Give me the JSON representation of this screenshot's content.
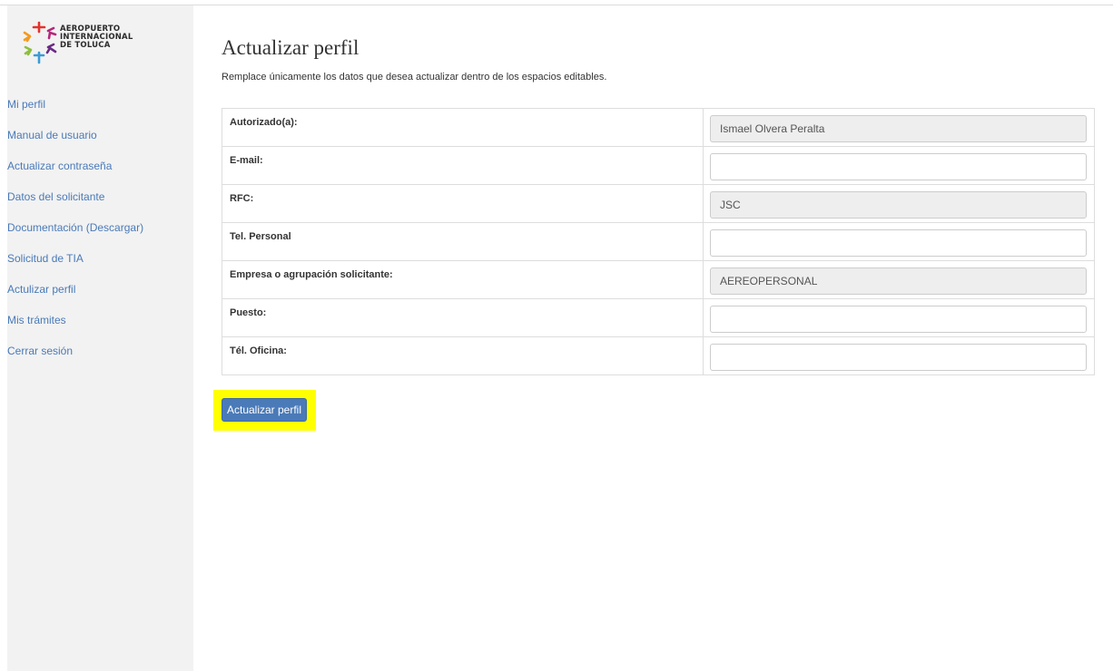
{
  "brand": {
    "logo_lines": [
      "AEROPUERTO",
      "INTERNACIONAL",
      "DE TOLUCA"
    ],
    "colors": {
      "orange": "#f39a1e",
      "red": "#e4312b",
      "magenta": "#b4287c",
      "purple": "#6b2a86",
      "green": "#8cbf3f",
      "blue": "#3a9bd5"
    }
  },
  "sidebar": {
    "items": [
      {
        "label": "Mi perfil"
      },
      {
        "label": "Manual de usuario"
      },
      {
        "label": "Actualizar contraseña"
      },
      {
        "label": "Datos del solicitante"
      },
      {
        "label": "Documentación (Descargar)"
      },
      {
        "label": "Solicitud de TIA"
      },
      {
        "label": "Actulizar perfil"
      },
      {
        "label": "Mis trámites"
      },
      {
        "label": "Cerrar sesión"
      }
    ]
  },
  "page": {
    "title": "Actualizar perfil",
    "subtitle": "Remplace únicamente los datos que desea actualizar dentro de los espacios editables."
  },
  "form": {
    "rows": [
      {
        "label": "Autorizado(a):",
        "value": "Ismael Olvera Peralta",
        "readonly": true
      },
      {
        "label": "E-mail:",
        "value": "",
        "readonly": false
      },
      {
        "label": "RFC:",
        "value": "JSC",
        "readonly": true
      },
      {
        "label": "Tel. Personal",
        "value": "",
        "readonly": false
      },
      {
        "label": "Empresa o agrupación solicitante:",
        "value": "AEREOPERSONAL",
        "readonly": true
      },
      {
        "label": "Puesto:",
        "value": "",
        "readonly": false
      },
      {
        "label": "Tél. Oficina:",
        "value": "",
        "readonly": false
      }
    ],
    "submit_label": "Actualizar perfil"
  },
  "colors": {
    "link": "#4a7ab8",
    "button": "#4a7ab8",
    "highlight": "#ffff00",
    "sidebar_bg": "#f2f2f2"
  }
}
